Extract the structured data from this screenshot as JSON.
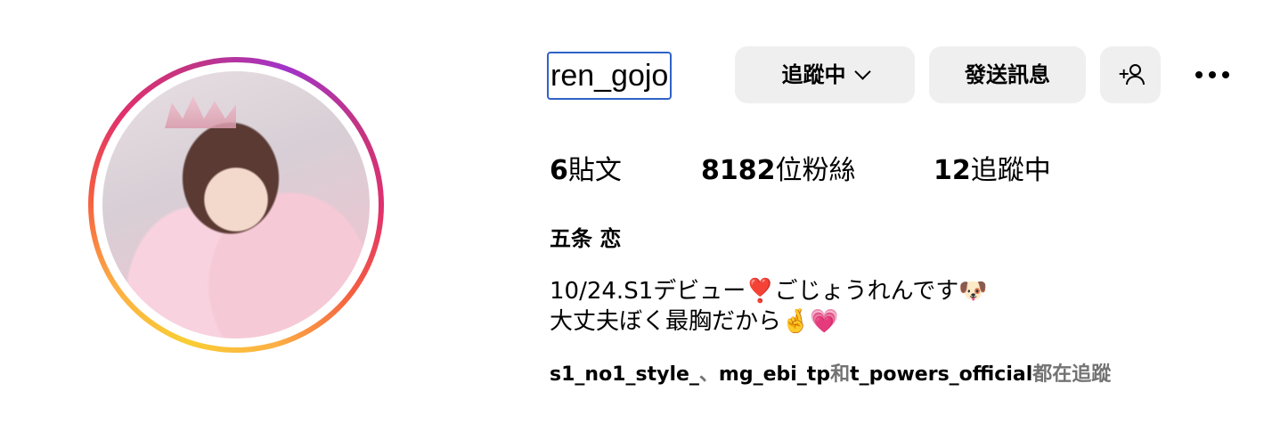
{
  "profile": {
    "username": "ren_gojo",
    "full_name": "五条 恋",
    "bio_line1": "10/24.S1デビュー❣️ごじょうれんです🐶",
    "bio_line2": "大丈夫ぼく最胸だから🤞💗",
    "avatar_alt": "ren_gojo 的大頭貼照"
  },
  "actions": {
    "following_label": "追蹤中",
    "message_label": "發送訊息",
    "add_user_icon": "add-user-icon",
    "more_icon": "more-options-icon"
  },
  "stats": {
    "posts_count": "6",
    "posts_label": "貼文",
    "followers_count": "8182",
    "followers_label": "位粉絲",
    "following_count": "12",
    "following_label": "追蹤中"
  },
  "followed_by": {
    "account1": "s1_no1_style_",
    "sep1": "、",
    "account2": "mg_ebi_tp",
    "sep2": "和",
    "account3": "t_powers_official",
    "suffix": "都在追蹤"
  },
  "colors": {
    "button_bg": "#efefef",
    "focus_border": "#2f63c7",
    "muted_text": "#737373"
  }
}
